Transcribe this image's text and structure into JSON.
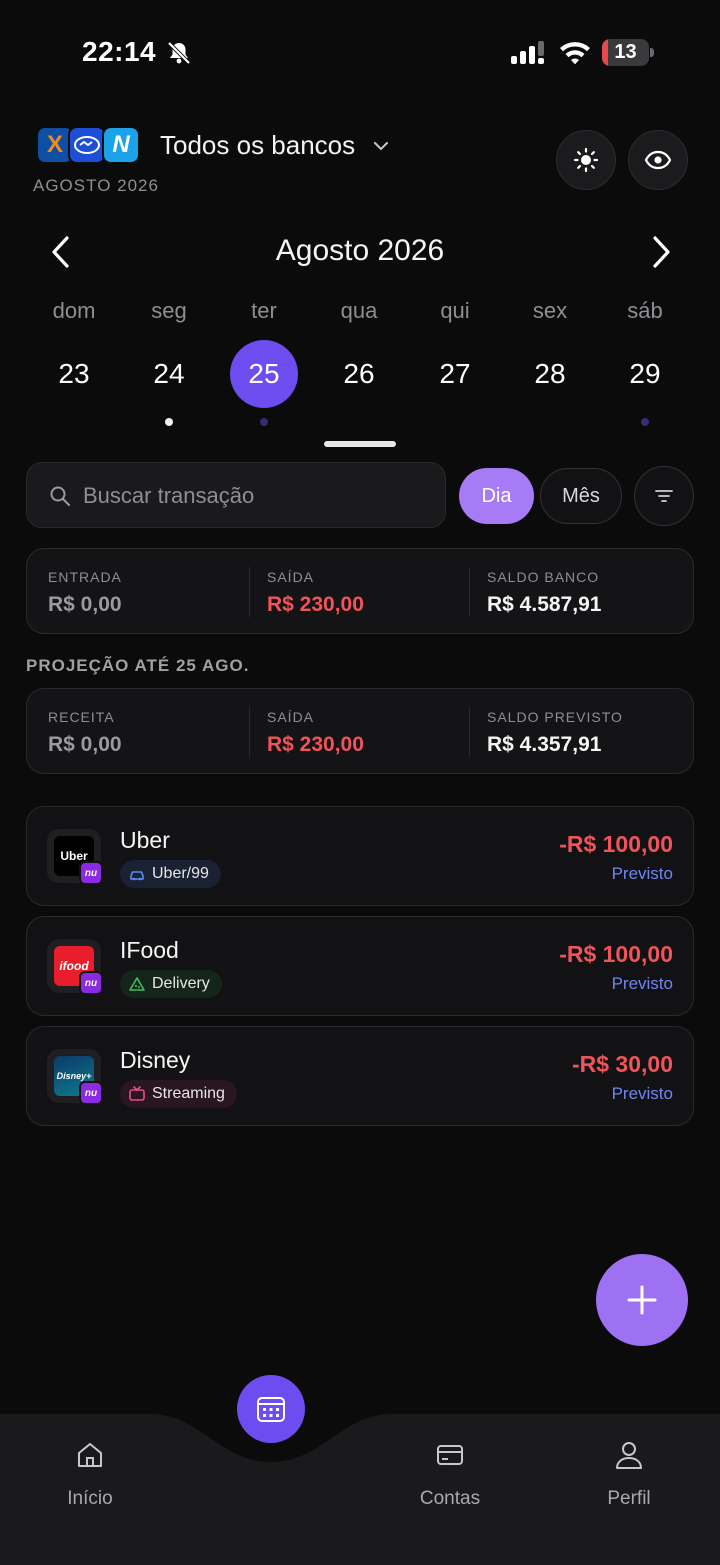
{
  "status_bar": {
    "time": "22:14",
    "battery": "13",
    "battery_level": 0.13
  },
  "header": {
    "bank_selector": "Todos os bancos",
    "month_caption": "AGOSTO 2026"
  },
  "calendar": {
    "title": "Agosto 2026",
    "weekdays": [
      "dom",
      "seg",
      "ter",
      "qua",
      "qui",
      "sex",
      "sáb"
    ],
    "days": [
      "23",
      "24",
      "25",
      "26",
      "27",
      "28",
      "29"
    ],
    "selected_day": "25"
  },
  "search": {
    "placeholder": "Buscar transação"
  },
  "view_toggle": {
    "day": "Dia",
    "month": "Mês"
  },
  "summary": {
    "income_label": "ENTRADA",
    "income_value": "R$ 0,00",
    "expense_label": "SAÍDA",
    "expense_value": "R$ 230,00",
    "balance_label": "SALDO BANCO",
    "balance_value": "R$ 4.587,91"
  },
  "projection": {
    "title": "PROJEÇÃO ATÉ 25 AGO.",
    "revenue_label": "RECEITA",
    "revenue_value": "R$ 0,00",
    "expense_label": "SAÍDA",
    "expense_value": "R$ 230,00",
    "forecast_label": "SALDO PREVISTO",
    "forecast_value": "R$ 4.357,91"
  },
  "transactions": [
    {
      "name": "Uber",
      "logo_text": "Uber",
      "category": "Uber/99",
      "amount": "-R$ 100,00",
      "status": "Previsto",
      "bank_badge": "nu"
    },
    {
      "name": "IFood",
      "logo_text": "ifood",
      "category": "Delivery",
      "amount": "-R$ 100,00",
      "status": "Previsto",
      "bank_badge": "nu"
    },
    {
      "name": "Disney",
      "logo_text": "Disney+",
      "category": "Streaming",
      "amount": "-R$ 30,00",
      "status": "Previsto",
      "bank_badge": "nu"
    }
  ],
  "nav": {
    "home": "Início",
    "accounts": "Contas",
    "profile": "Perfil"
  },
  "colors": {
    "accent": "#6d4cf0",
    "accent_light": "#a77bf5",
    "negative": "#f0545a",
    "forecast_text": "#6f86f0",
    "background": "#0b0b0c"
  }
}
